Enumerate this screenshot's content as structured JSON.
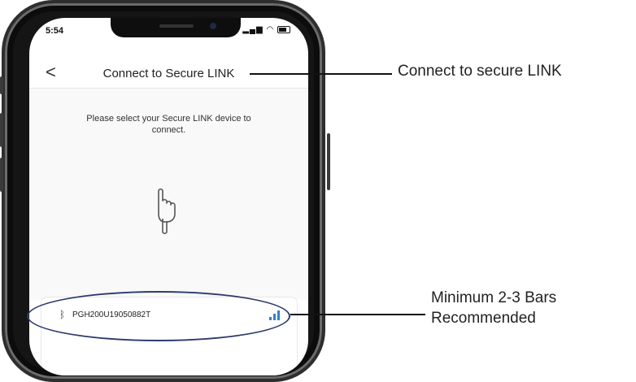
{
  "status_bar": {
    "time": "5:54"
  },
  "navbar": {
    "back_glyph": "<",
    "title": "Connect to Secure LINK"
  },
  "content": {
    "prompt": "Please select your Secure LINK device to connect.",
    "pointer_icon": "hand-pointing-down-icon"
  },
  "device_list": {
    "items": [
      {
        "name": "PGH200U19050882T",
        "signal_bars": 3,
        "bluetooth_icon": "bluetooth-icon"
      }
    ]
  },
  "callouts": {
    "top": "Connect to secure LINK",
    "bottom_line1": "Minimum 2-3 Bars",
    "bottom_line2": "Recommended"
  },
  "colors": {
    "signal": "#2f7fd6",
    "ellipse": "#2d3a6e"
  }
}
